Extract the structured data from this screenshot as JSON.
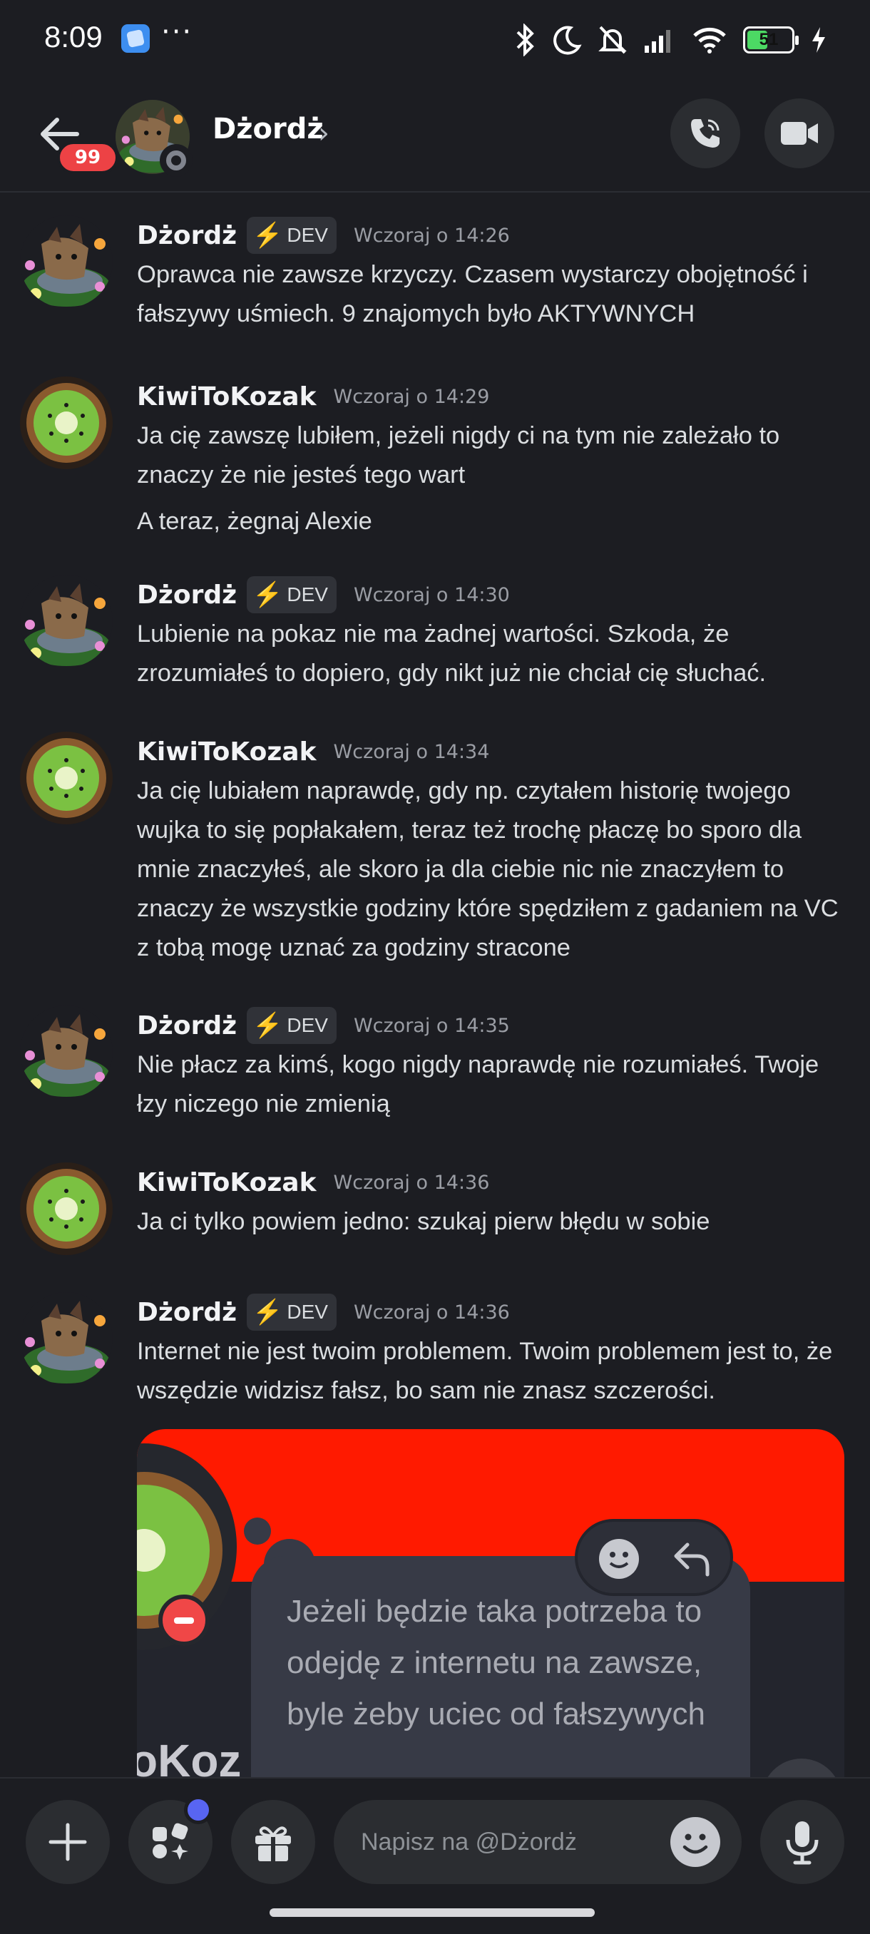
{
  "status_bar": {
    "time": "8:09",
    "more": "···",
    "battery_level": "51",
    "battery_fraction": 0.51
  },
  "header": {
    "back_icon": "arrow-left-icon",
    "unread_count": "99",
    "name": "Dżordż",
    "chevron": "›",
    "call_icon": "phone-call-icon",
    "video_icon": "video-camera-icon"
  },
  "messages": [
    {
      "author": "Dżordż",
      "tag": "DEV",
      "timestamp": "Wczoraj o 14:26",
      "lines": [
        "Oprawca nie zawsze krzyczy. Czasem wystarczy obojętność i fałszywy uśmiech. 9 znajomych było AKTYWNYCH"
      ]
    },
    {
      "author": "KiwiToKozak",
      "timestamp": "Wczoraj o 14:29",
      "lines": [
        "Ja cię zawszę lubiłem, jeżeli nigdy ci na tym nie zależało to znaczy że nie jesteś tego wart",
        "A teraz, żegnaj Alexie"
      ]
    },
    {
      "author": "Dżordż",
      "tag": "DEV",
      "timestamp": "Wczoraj o 14:30",
      "lines": [
        "Lubienie na pokaz nie ma żadnej wartości. Szkoda, że zrozumiałeś to dopiero, gdy nikt już nie chciał cię słuchać."
      ]
    },
    {
      "author": "KiwiToKozak",
      "timestamp": "Wczoraj o 14:34",
      "lines": [
        "Ja cię lubiałem naprawdę, gdy np. czytałem historię twojego wujka to się popłakałem, teraz też trochę płaczę bo sporo dla mnie znaczyłeś, ale skoro ja dla ciebie nic nie znaczyłem to znaczy że wszystkie godziny które spędziłem z gadaniem na VC z tobą mogę uznać za godziny stracone"
      ]
    },
    {
      "author": "Dżordż",
      "tag": "DEV",
      "timestamp": "Wczoraj o 14:35",
      "lines": [
        "Nie płacz za kimś, kogo nigdy naprawdę nie rozumiałeś. Twoje łzy niczego nie zmienią"
      ]
    },
    {
      "author": "KiwiToKozak",
      "timestamp": "Wczoraj o 14:36",
      "lines": [
        "Ja ci tylko powiem jedno: szukaj pierw błędu w sobie"
      ]
    },
    {
      "author": "Dżordż",
      "tag": "DEV",
      "timestamp": "Wczoraj o 14:36",
      "lines": [
        "Internet nie jest twoim problemem. Twoim problemem jest to, że wszędzie widzisz fałsz, bo sam nie znasz szczerości."
      ]
    }
  ],
  "embed": {
    "text": "Jeżeli będzie taka potrzeba to odejdę z internetu na zawsze, byle żeby uciec od fałszywych",
    "partial_name": "oKoz"
  },
  "composer": {
    "placeholder": "Napisz na @Dżordż",
    "add_icon": "plus-icon",
    "apps_icon": "apps-icon",
    "gift_icon": "gift-icon",
    "emoji_icon": "emoji-icon",
    "mic_icon": "microphone-icon"
  },
  "colors": {
    "background": "#1c1d22",
    "unread_badge": "#ed4245",
    "dev_bolt": "#f5c33b",
    "embed_banner": "#ff1a00",
    "notification_dot": "#5865f2"
  }
}
